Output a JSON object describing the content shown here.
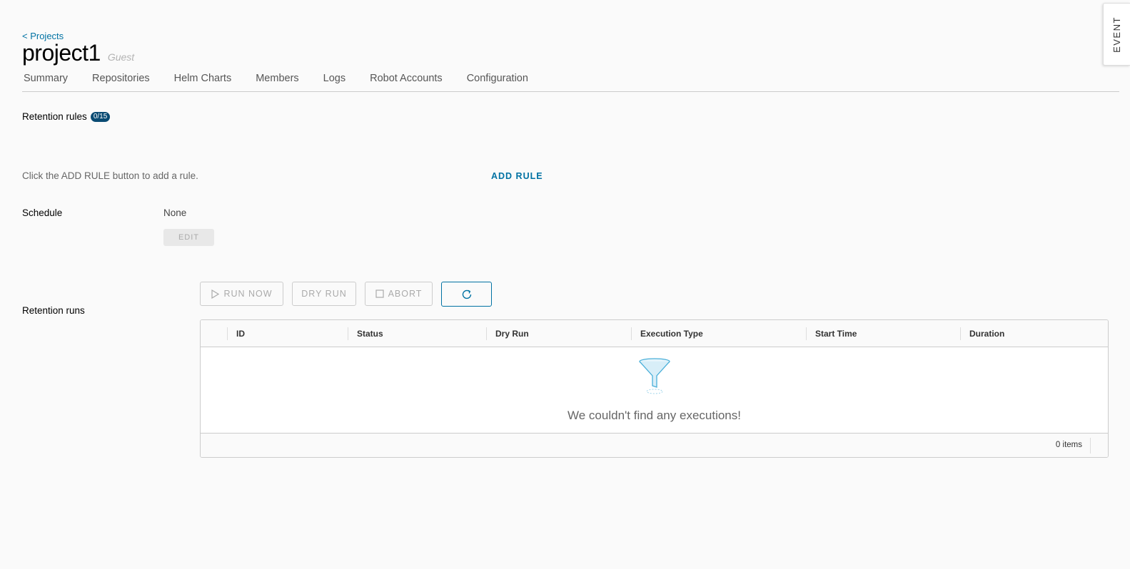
{
  "header": {
    "back_link": "< Projects",
    "project_name": "project1",
    "role": "Guest"
  },
  "tabs": [
    {
      "label": "Summary"
    },
    {
      "label": "Repositories"
    },
    {
      "label": "Helm Charts"
    },
    {
      "label": "Members"
    },
    {
      "label": "Logs"
    },
    {
      "label": "Robot Accounts"
    },
    {
      "label": "Configuration"
    }
  ],
  "event_tab": {
    "label": "EVENT"
  },
  "retention_rules": {
    "label": "Retention rules",
    "badge": "0/15",
    "hint": "Click the ADD RULE button to add a rule.",
    "add_rule_label": "ADD RULE"
  },
  "schedule": {
    "label": "Schedule",
    "value": "None",
    "edit_label": "EDIT"
  },
  "runs": {
    "label": "Retention runs",
    "run_now_label": "RUN NOW",
    "dry_run_label": "DRY RUN",
    "abort_label": "ABORT",
    "columns": [
      "ID",
      "Status",
      "Dry Run",
      "Execution Type",
      "Start Time",
      "Duration"
    ],
    "empty_message": "We couldn't find any executions!",
    "items_count": "0 items"
  },
  "colors": {
    "accent": "#0072a3",
    "badge_bg": "#0a4b73",
    "background": "#fafafa"
  },
  "icons": {
    "run_now": "play-icon",
    "abort": "stop-icon",
    "refresh": "refresh-icon",
    "empty": "funnel-icon"
  }
}
